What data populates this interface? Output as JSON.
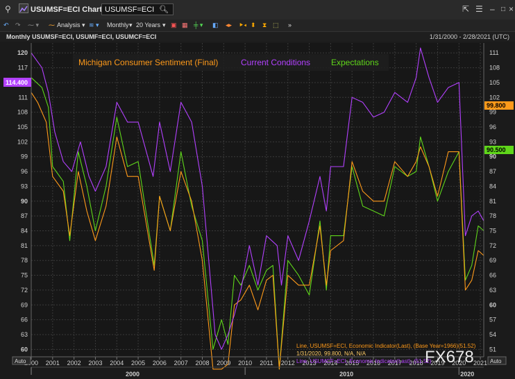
{
  "window": {
    "title": "USUMSF=ECI Chart",
    "search_value": "USUMSF=ECI"
  },
  "toolbar": {
    "analysis_label": "Analysis",
    "interval_label": "Monthly",
    "range_label": "20 Years"
  },
  "info": {
    "series_codes": "Monthly USUMSF=ECI, USUMF=ECI, USUMCF=ECI",
    "date_range": "1/31/2000 - 2/28/2021 (UTC)"
  },
  "colors": {
    "michigan": "#ff9a1a",
    "current": "#b341ff",
    "expectations": "#5fd61a",
    "grid": "#3a3a3a"
  },
  "badges": {
    "left_value": "114.400",
    "right_orange": "99.800",
    "right_green": "90.500"
  },
  "legend": {
    "michigan": "Michigan Consumer Sentiment (Final)",
    "current": "Current Conditions",
    "expectations": "Expectations"
  },
  "footnotes": [
    "Line, USUMSF=ECI, Economic Indicator(Last), (Base Year=1966)(51.52)",
    "1/31/2020, 99.800, N/A, N/A",
    "Line, USUMCF=ECI, Economic Indicator(Last), (51.52)"
  ],
  "watermark": "FX678",
  "auto_labels": {
    "left": "Auto",
    "right": "Auto"
  },
  "chart_data": {
    "type": "line",
    "x_labels": [
      "2000",
      "2001",
      "2002",
      "2003",
      "2004",
      "2005",
      "2006",
      "2007",
      "2008",
      "2009",
      "2010",
      "2011",
      "2012",
      "2013",
      "2014",
      "2015",
      "2016",
      "2017",
      "2018",
      "2019",
      "2020",
      "2021"
    ],
    "decade_labels": [
      "2000",
      "2010",
      "2020"
    ],
    "y_left_ticks": [
      60,
      63,
      66,
      69,
      72,
      75,
      78,
      81,
      84,
      87,
      90,
      93,
      96,
      99,
      102,
      105,
      108,
      111,
      114,
      117,
      120
    ],
    "y_right_ticks": [
      51,
      54,
      57,
      60,
      63,
      66,
      69,
      72,
      75,
      78,
      81,
      84,
      87,
      90,
      93,
      96,
      99,
      102,
      105,
      108,
      111
    ],
    "ylim_left": [
      58.5,
      122
    ],
    "ylim_right": [
      49.5,
      113
    ],
    "xlim": [
      2000.0,
      2021.16
    ],
    "series": [
      {
        "name": "Michigan Consumer Sentiment (Final)",
        "axis": "left",
        "points": [
          [
            2000.0,
            112
          ],
          [
            2000.3,
            110
          ],
          [
            2000.7,
            106
          ],
          [
            2001.0,
            95
          ],
          [
            2001.5,
            92
          ],
          [
            2001.8,
            83
          ],
          [
            2002.2,
            96
          ],
          [
            2002.6,
            88
          ],
          [
            2003.0,
            82
          ],
          [
            2003.5,
            89
          ],
          [
            2004.0,
            103
          ],
          [
            2004.5,
            95
          ],
          [
            2005.0,
            95
          ],
          [
            2005.75,
            76
          ],
          [
            2006.0,
            91
          ],
          [
            2006.5,
            84
          ],
          [
            2007.0,
            96
          ],
          [
            2007.5,
            90
          ],
          [
            2008.0,
            78
          ],
          [
            2008.5,
            56
          ],
          [
            2008.9,
            56
          ],
          [
            2009.2,
            57
          ],
          [
            2009.5,
            69
          ],
          [
            2009.8,
            70
          ],
          [
            2010.2,
            73
          ],
          [
            2010.6,
            68
          ],
          [
            2011.0,
            74
          ],
          [
            2011.3,
            75
          ],
          [
            2011.6,
            56
          ],
          [
            2012.0,
            75
          ],
          [
            2012.5,
            73
          ],
          [
            2013.0,
            73
          ],
          [
            2013.5,
            85
          ],
          [
            2013.8,
            73
          ],
          [
            2014.0,
            80
          ],
          [
            2014.6,
            82
          ],
          [
            2015.0,
            98
          ],
          [
            2015.5,
            92
          ],
          [
            2016.0,
            90
          ],
          [
            2016.5,
            90
          ],
          [
            2017.0,
            98
          ],
          [
            2017.6,
            95
          ],
          [
            2018.0,
            98
          ],
          [
            2018.2,
            101
          ],
          [
            2018.6,
            97
          ],
          [
            2019.0,
            91
          ],
          [
            2019.5,
            100
          ],
          [
            2020.0,
            100
          ],
          [
            2020.3,
            72
          ],
          [
            2020.6,
            74
          ],
          [
            2020.9,
            80
          ],
          [
            2021.16,
            79
          ]
        ]
      },
      {
        "name": "Current Conditions",
        "axis": "left",
        "points": [
          [
            2000.0,
            120
          ],
          [
            2000.5,
            117
          ],
          [
            2000.8,
            112
          ],
          [
            2001.1,
            104
          ],
          [
            2001.5,
            98
          ],
          [
            2001.9,
            96
          ],
          [
            2002.3,
            102
          ],
          [
            2002.7,
            95
          ],
          [
            2003.0,
            92
          ],
          [
            2003.5,
            97
          ],
          [
            2004.0,
            110
          ],
          [
            2004.5,
            106
          ],
          [
            2005.0,
            106
          ],
          [
            2005.7,
            95
          ],
          [
            2006.0,
            106
          ],
          [
            2006.5,
            96
          ],
          [
            2007.0,
            110
          ],
          [
            2007.5,
            106
          ],
          [
            2008.0,
            93
          ],
          [
            2008.6,
            63
          ],
          [
            2008.9,
            60
          ],
          [
            2009.2,
            63
          ],
          [
            2009.5,
            67
          ],
          [
            2009.8,
            72
          ],
          [
            2010.2,
            81
          ],
          [
            2010.6,
            73
          ],
          [
            2011.0,
            83
          ],
          [
            2011.5,
            81
          ],
          [
            2011.7,
            73
          ],
          [
            2012.0,
            83
          ],
          [
            2012.5,
            78
          ],
          [
            2013.0,
            86
          ],
          [
            2013.5,
            95
          ],
          [
            2013.8,
            88
          ],
          [
            2014.0,
            97
          ],
          [
            2014.6,
            97
          ],
          [
            2015.0,
            111
          ],
          [
            2015.5,
            110
          ],
          [
            2016.0,
            107
          ],
          [
            2016.5,
            108
          ],
          [
            2017.0,
            112
          ],
          [
            2017.6,
            110
          ],
          [
            2018.0,
            115
          ],
          [
            2018.2,
            121
          ],
          [
            2018.6,
            115
          ],
          [
            2019.0,
            110
          ],
          [
            2019.5,
            113
          ],
          [
            2020.0,
            114
          ],
          [
            2020.3,
            83
          ],
          [
            2020.6,
            87
          ],
          [
            2020.9,
            88
          ],
          [
            2021.16,
            86
          ]
        ]
      },
      {
        "name": "Expectations",
        "axis": "right",
        "points": [
          [
            2000.0,
            106
          ],
          [
            2000.5,
            104
          ],
          [
            2000.8,
            100
          ],
          [
            2001.0,
            88
          ],
          [
            2001.5,
            85
          ],
          [
            2001.8,
            73
          ],
          [
            2002.2,
            91
          ],
          [
            2002.6,
            84
          ],
          [
            2003.0,
            75
          ],
          [
            2003.5,
            84
          ],
          [
            2004.0,
            98
          ],
          [
            2004.5,
            88
          ],
          [
            2005.0,
            89
          ],
          [
            2005.75,
            68
          ],
          [
            2006.0,
            82
          ],
          [
            2006.5,
            75
          ],
          [
            2007.0,
            91
          ],
          [
            2007.5,
            80
          ],
          [
            2008.0,
            73
          ],
          [
            2008.5,
            51
          ],
          [
            2008.9,
            57
          ],
          [
            2009.2,
            52
          ],
          [
            2009.5,
            66
          ],
          [
            2009.8,
            64
          ],
          [
            2010.2,
            68
          ],
          [
            2010.6,
            63
          ],
          [
            2011.0,
            67
          ],
          [
            2011.3,
            68
          ],
          [
            2011.6,
            47
          ],
          [
            2012.0,
            69
          ],
          [
            2012.5,
            66
          ],
          [
            2013.0,
            62
          ],
          [
            2013.5,
            77
          ],
          [
            2013.8,
            63
          ],
          [
            2014.0,
            74
          ],
          [
            2014.6,
            74
          ],
          [
            2015.0,
            88
          ],
          [
            2015.5,
            80
          ],
          [
            2016.0,
            79
          ],
          [
            2016.5,
            78
          ],
          [
            2017.0,
            88
          ],
          [
            2017.6,
            86
          ],
          [
            2018.0,
            87
          ],
          [
            2018.2,
            94
          ],
          [
            2018.6,
            88
          ],
          [
            2019.0,
            81
          ],
          [
            2019.5,
            87
          ],
          [
            2020.0,
            91
          ],
          [
            2020.3,
            65
          ],
          [
            2020.6,
            68
          ],
          [
            2020.9,
            76
          ],
          [
            2021.16,
            75
          ]
        ]
      }
    ]
  }
}
